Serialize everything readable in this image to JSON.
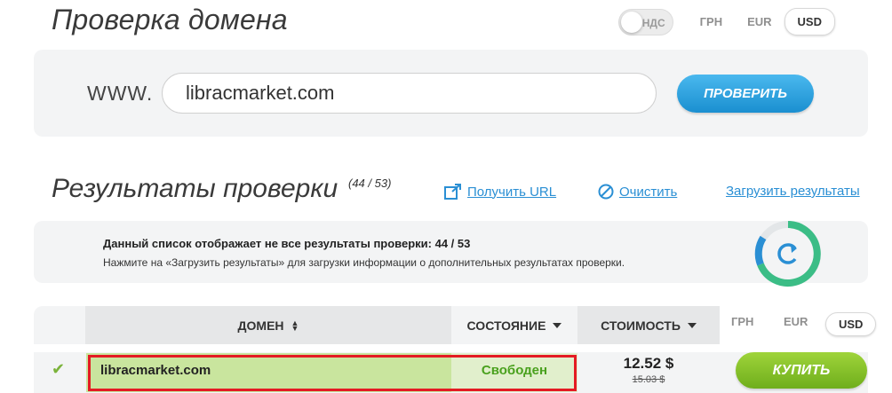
{
  "header": {
    "title": "Проверка домена",
    "vat_label": "НДС",
    "currencies": [
      "ГРН",
      "EUR",
      "USD"
    ],
    "active_currency": "USD"
  },
  "search": {
    "prefix": "WWW.",
    "value": "libracmarket.com",
    "button_label": "ПРОВЕРИТЬ"
  },
  "results": {
    "title": "Результаты проверки",
    "count": "(44 / 53)",
    "links": {
      "get_url": "Получить URL",
      "clear": "Очистить",
      "load": "Загрузить результаты"
    }
  },
  "notice": {
    "line1": "Данный список отображает не все результаты проверки: 44 / 53",
    "line2": "Нажмите на «Загрузить результаты» для загрузки информации о дополнительных результатах проверки."
  },
  "table": {
    "headers": {
      "domain": "ДОМЕН",
      "state": "СОСТОЯНИЕ",
      "cost": "СТОИМОСТЬ"
    },
    "currencies": [
      "ГРН",
      "EUR",
      "USD"
    ],
    "active_currency": "USD",
    "rows": [
      {
        "domain": "libracmarket.com",
        "state": "Свободен",
        "price": "12.52 $",
        "old_price": "15.03 $",
        "button_label": "КУПИТЬ"
      }
    ]
  },
  "colors": {
    "accent_blue": "#1a8fd0",
    "buy_green": "#6fae1c",
    "available_green": "#4aa11e",
    "highlight_red": "#e41b23"
  }
}
